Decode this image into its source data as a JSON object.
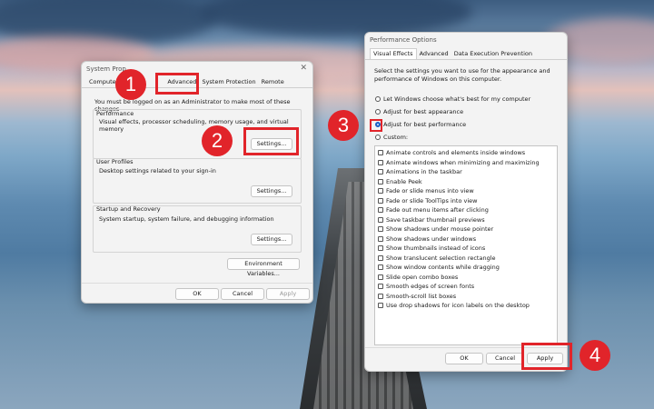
{
  "system_properties": {
    "title": "System Prop",
    "tabs": [
      "Computer",
      "Advanced",
      "System Protection",
      "Remote"
    ],
    "admin_note": "You must be logged on as an Administrator to make most of these changes",
    "performance": {
      "title": "Performance",
      "desc": "Visual effects, processor scheduling, memory usage, and virtual memory",
      "button": "Settings..."
    },
    "user_profiles": {
      "title": "User Profiles",
      "desc": "Desktop settings related to your sign-in",
      "button": "Settings..."
    },
    "startup": {
      "title": "Startup and Recovery",
      "desc": "System startup, system failure, and debugging information",
      "button": "Settings..."
    },
    "env_button": "Environment Variables...",
    "ok": "OK",
    "cancel": "Cancel",
    "apply": "Apply"
  },
  "performance_options": {
    "title": "Performance Options",
    "tabs": [
      "Visual Effects",
      "Advanced",
      "Data Execution Prevention"
    ],
    "intro": "Select the settings you want to use for the appearance and performance of Windows on this computer.",
    "radios": [
      {
        "label": "Let Windows choose what's best for my computer",
        "selected": false
      },
      {
        "label": "Adjust for best appearance",
        "selected": false
      },
      {
        "label": "Adjust for best performance",
        "selected": true
      },
      {
        "label": "Custom:",
        "selected": false
      }
    ],
    "effects": [
      "Animate controls and elements inside windows",
      "Animate windows when minimizing and maximizing",
      "Animations in the taskbar",
      "Enable Peek",
      "Fade or slide menus into view",
      "Fade or slide ToolTips into view",
      "Fade out menu items after clicking",
      "Save taskbar thumbnail previews",
      "Show shadows under mouse pointer",
      "Show shadows under windows",
      "Show thumbnails instead of icons",
      "Show translucent selection rectangle",
      "Show window contents while dragging",
      "Slide open combo boxes",
      "Smooth edges of screen fonts",
      "Smooth-scroll list boxes",
      "Use drop shadows for icon labels on the desktop"
    ],
    "ok": "OK",
    "cancel": "Cancel",
    "apply": "Apply"
  },
  "badges": [
    "1",
    "2",
    "3",
    "4"
  ],
  "colors": {
    "highlight_red": "#e1242a",
    "radio_blue": "#1b5fc4"
  }
}
